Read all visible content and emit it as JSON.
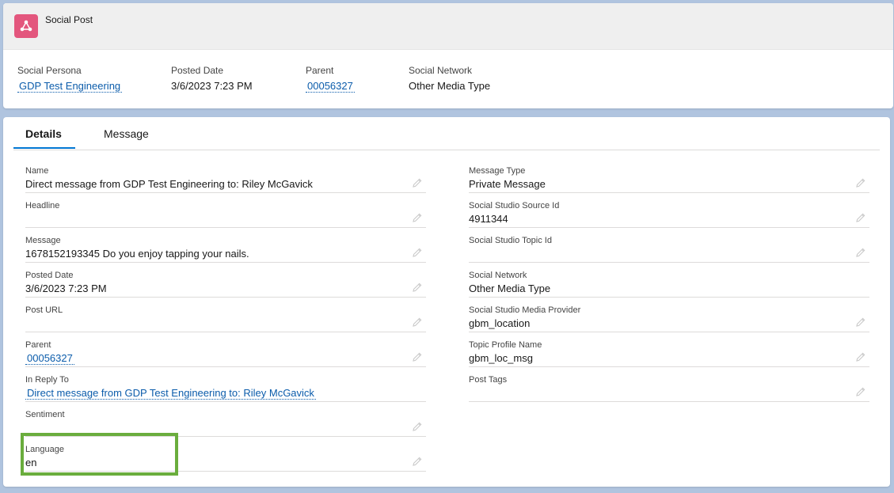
{
  "header": {
    "record_type": "Social Post",
    "icon": "social-post-icon",
    "accent_color": "#e3567d",
    "highlights": [
      {
        "label": "Social Persona",
        "value": "GDP Test Engineering",
        "is_link": true
      },
      {
        "label": "Posted Date",
        "value": "3/6/2023 7:23 PM",
        "is_link": false
      },
      {
        "label": "Parent",
        "value": "00056327",
        "is_link": true
      },
      {
        "label": "Social Network",
        "value": "Other Media Type",
        "is_link": false
      }
    ]
  },
  "tabs": [
    {
      "label": "Details",
      "active": true
    },
    {
      "label": "Message",
      "active": false
    }
  ],
  "details": {
    "left": [
      {
        "label": "Name",
        "value": "Direct message from GDP Test Engineering to: Riley McGavick",
        "is_link": false
      },
      {
        "label": "Headline",
        "value": "",
        "is_link": false
      },
      {
        "label": "Message",
        "value": "1678152193345 Do you enjoy tapping your nails.",
        "is_link": false
      },
      {
        "label": "Posted Date",
        "value": "3/6/2023 7:23 PM",
        "is_link": false
      },
      {
        "label": "Post URL",
        "value": "",
        "is_link": false
      },
      {
        "label": "Parent",
        "value": "00056327",
        "is_link": true
      },
      {
        "label": "In Reply To",
        "value": "Direct message from GDP Test Engineering to: Riley McGavick",
        "is_link": true,
        "editable": false
      },
      {
        "label": "Sentiment",
        "value": "",
        "is_link": false
      },
      {
        "label": "Language",
        "value": "en",
        "is_link": false
      }
    ],
    "right": [
      {
        "label": "Message Type",
        "value": "Private Message",
        "is_link": false
      },
      {
        "label": "Social Studio Source Id",
        "value": "4911344",
        "is_link": false
      },
      {
        "label": "Social Studio Topic Id",
        "value": "",
        "is_link": false
      },
      {
        "label": "Social Network",
        "value": "Other Media Type",
        "is_link": false,
        "editable": false
      },
      {
        "label": "Social Studio Media Provider",
        "value": "gbm_location",
        "is_link": false
      },
      {
        "label": "Topic Profile Name",
        "value": "gbm_loc_msg",
        "is_link": false
      },
      {
        "label": "Post Tags",
        "value": "",
        "is_link": false
      }
    ]
  },
  "colors": {
    "link": "#0b5cab",
    "tab_active_border": "#0176d3",
    "highlight_box": "#6aad3d",
    "page_background": "#b0c4df"
  }
}
